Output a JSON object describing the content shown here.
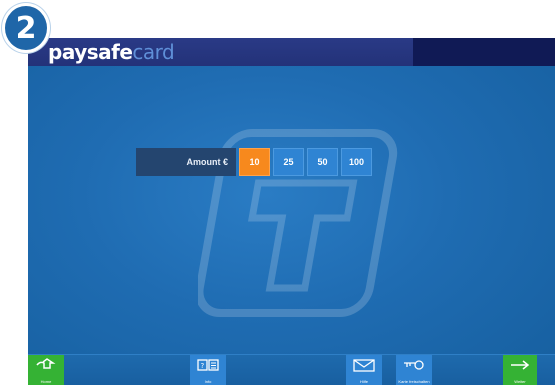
{
  "step": "2",
  "brand": {
    "part1": "paysafe",
    "part2": "card"
  },
  "amount": {
    "label": "Amount €",
    "options": [
      "10",
      "25",
      "50",
      "100"
    ],
    "selected": "10"
  },
  "footer": {
    "home": "Home",
    "info": "Info",
    "help": "Hilfe",
    "unlock": "Karte freischalten",
    "next": "Weiter"
  },
  "colors": {
    "screen_bg": "#1f6cb2",
    "header_bg": "#233279",
    "selected_amount": "#f7891d",
    "amount_button": "#2f84d3",
    "action_green": "#35b234"
  }
}
